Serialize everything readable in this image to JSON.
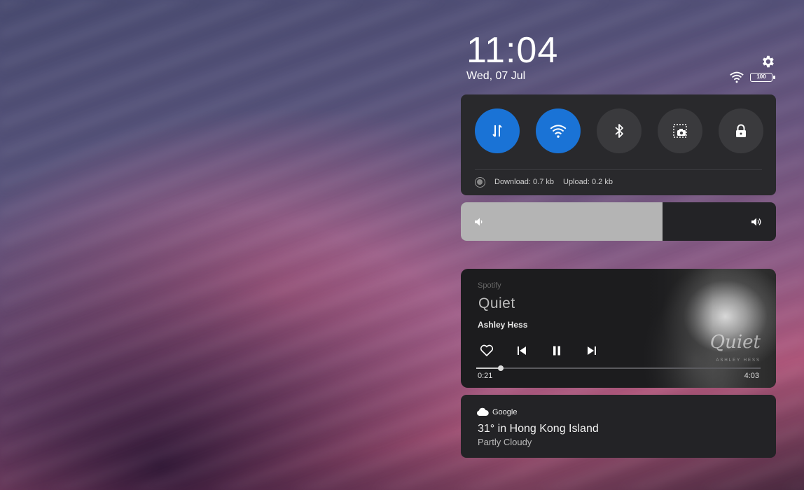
{
  "status": {
    "time": "11:04",
    "date": "Wed, 07 Jul",
    "battery_level": "100"
  },
  "quick_settings": {
    "toggles": [
      {
        "name": "data-transfer",
        "icon": "arrows-updown-icon",
        "active": true
      },
      {
        "name": "wifi",
        "icon": "wifi-icon",
        "active": true
      },
      {
        "name": "bluetooth",
        "icon": "bluetooth-icon",
        "active": false
      },
      {
        "name": "screenshot",
        "icon": "screenshot-icon",
        "active": false
      },
      {
        "name": "lock",
        "icon": "lock-icon",
        "active": false
      }
    ],
    "download_label": "Download: 0.7 kb",
    "upload_label": "Upload: 0.2 kb"
  },
  "volume": {
    "level_percent": 64
  },
  "media": {
    "app": "Spotify",
    "title": "Quiet",
    "artist": "Ashley Hess",
    "album_art_title": "Quiet",
    "album_art_artist": "ASHLEY HESS",
    "elapsed": "0:21",
    "duration": "4:03",
    "progress_fraction": 0.086
  },
  "weather": {
    "provider": "Google",
    "headline": "31° in Hong Kong Island",
    "condition": "Partly Cloudy"
  },
  "colors": {
    "accent": "#1a73d6",
    "panel": "#29292c"
  }
}
